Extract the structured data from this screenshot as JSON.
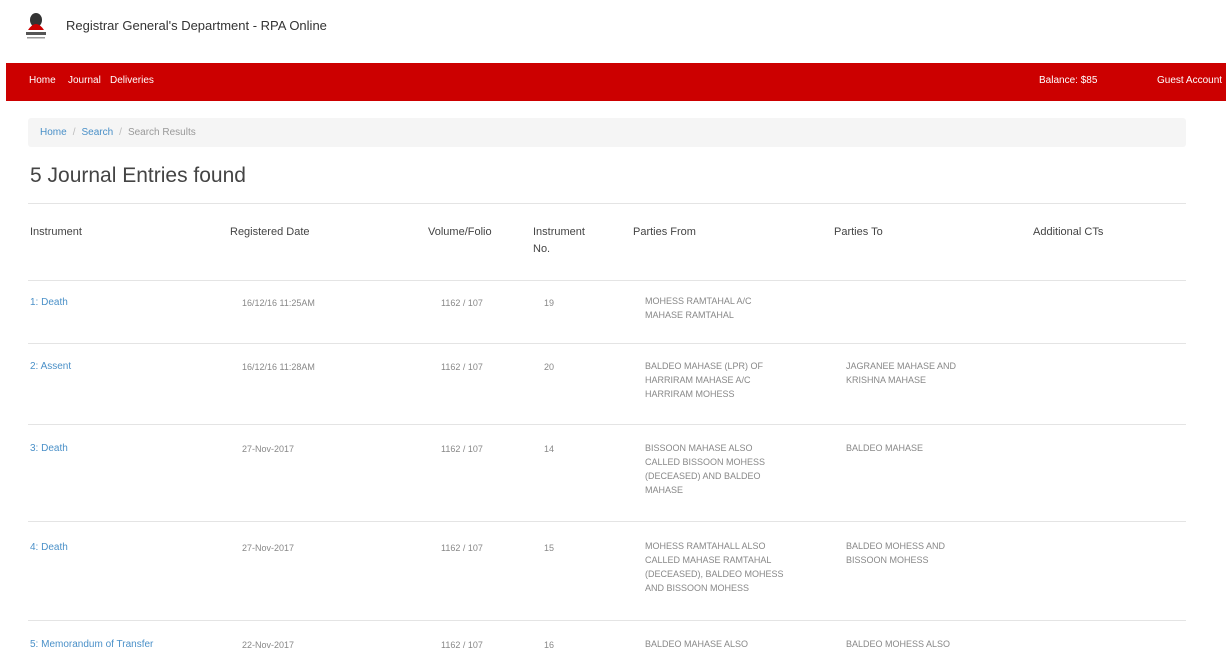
{
  "header": {
    "title": "Registrar General's Department - RPA Online",
    "logo_icon": "coat-of-arms-logo"
  },
  "nav": {
    "home": "Home",
    "journal": "Journal",
    "deliveries": "Deliveries",
    "balance": "Balance: $85",
    "account": "Guest Account"
  },
  "breadcrumb": {
    "home": "Home",
    "search": "Search",
    "current": "Search Results"
  },
  "page": {
    "title": "5 Journal Entries found"
  },
  "table": {
    "columns": {
      "instrument": "Instrument",
      "registered_date": "Registered Date",
      "volume_folio": "Volume/Folio",
      "instrument_no": "Instrument No.",
      "parties_from": "Parties From",
      "parties_to": "Parties To",
      "additional_cts": "Additional CTs"
    },
    "rows": [
      {
        "instrument": "1: Death",
        "registered_date": "16/12/16 11:25AM",
        "volume_folio": "1162 / 107",
        "instrument_no": "19",
        "parties_from": "MOHESS RAMTAHAL A/C MAHASE RAMTAHAL",
        "parties_to": "",
        "additional_cts": ""
      },
      {
        "instrument": "2: Assent",
        "registered_date": "16/12/16 11:28AM",
        "volume_folio": "1162 / 107",
        "instrument_no": "20",
        "parties_from": "BALDEO MAHASE (LPR) OF HARRIRAM MAHASE A/C HARRIRAM MOHESS",
        "parties_to": "JAGRANEE MAHASE AND KRISHNA MAHASE",
        "additional_cts": ""
      },
      {
        "instrument": "3: Death",
        "registered_date": "27-Nov-2017",
        "volume_folio": "1162 / 107",
        "instrument_no": "14",
        "parties_from": "BISSOON MAHASE ALSO CALLED BISSOON MOHESS (DECEASED) AND BALDEO MAHASE",
        "parties_to": "BALDEO MAHASE",
        "additional_cts": ""
      },
      {
        "instrument": "4: Death",
        "registered_date": "27-Nov-2017",
        "volume_folio": "1162 / 107",
        "instrument_no": "15",
        "parties_from": "MOHESS RAMTAHALL ALSO CALLED MAHASE RAMTAHAL (DECEASED), BALDEO MOHESS AND BISSOON MOHESS",
        "parties_to": "BALDEO MOHESS AND BISSOON MOHESS",
        "additional_cts": ""
      },
      {
        "instrument": "5: Memorandum of Transfer",
        "registered_date": "22-Nov-2017",
        "volume_folio": "1162 / 107",
        "instrument_no": "16",
        "parties_from": "BALDEO MAHASE ALSO",
        "parties_to": "BALDEO MOHESS ALSO",
        "additional_cts": ""
      }
    ]
  },
  "colors": {
    "navbar": "#cc0000",
    "link": "#4a90c8",
    "muted_text": "#888888"
  }
}
